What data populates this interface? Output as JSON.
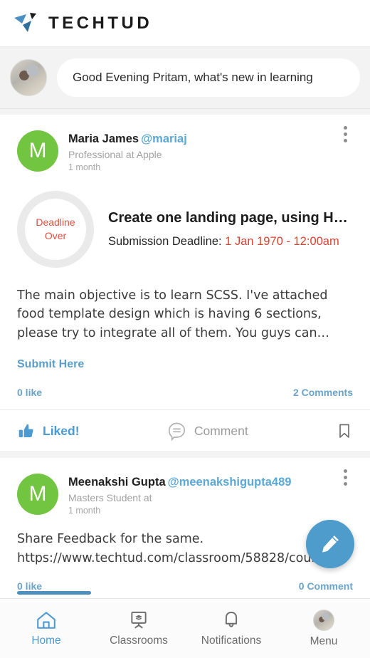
{
  "app": {
    "brand_name": "TECHTUD",
    "accent_blue": "#4b9ad2",
    "avatar_green": "#72c540",
    "deadline_red": "#d9432e"
  },
  "greeting": {
    "text": "Good Evening Pritam, what's new in learning",
    "placeholder": "Good Evening Pritam, what's new in learning",
    "avatar_name": "user-avatar"
  },
  "posts": [
    {
      "avatar_initial": "M",
      "name": "Maria James",
      "handle": "@mariaj",
      "subtitle": "Professional at Apple",
      "time": "1 month",
      "deadline_badge_line1": "Deadline",
      "deadline_badge_line2": "Over",
      "task_title": "Create one landing page, using HT…",
      "submission_label": "Submission Deadline:",
      "submission_date": "1 Jan 1970 - 12:00am",
      "body": "The main objective is to learn SCSS. I've attached food template design which is having 6 sections, please try to integrate all of them.  You guys can…",
      "submit_link": "Submit Here",
      "likes": "0 like",
      "comments": "2 Comments",
      "like_label": "Liked!",
      "comment_label": "Comment"
    },
    {
      "avatar_initial": "M",
      "name": "Meenakshi Gupta",
      "handle": "@meenakshigupta489",
      "subtitle": "Masters Student at",
      "time": "1 month",
      "body": "Share Feedback for the same. https://www.techtud.com/classroom/58828/courses",
      "likes": "0 like",
      "comments": "0 Comment"
    }
  ],
  "fab": {
    "action": "compose"
  },
  "bottom_nav": {
    "items": [
      {
        "label": "Home",
        "icon": "home-icon",
        "active": true
      },
      {
        "label": "Classrooms",
        "icon": "classroom-icon",
        "active": false
      },
      {
        "label": "Notifications",
        "icon": "bell-icon",
        "active": false
      },
      {
        "label": "Menu",
        "icon": "avatar-icon",
        "active": false
      }
    ]
  }
}
